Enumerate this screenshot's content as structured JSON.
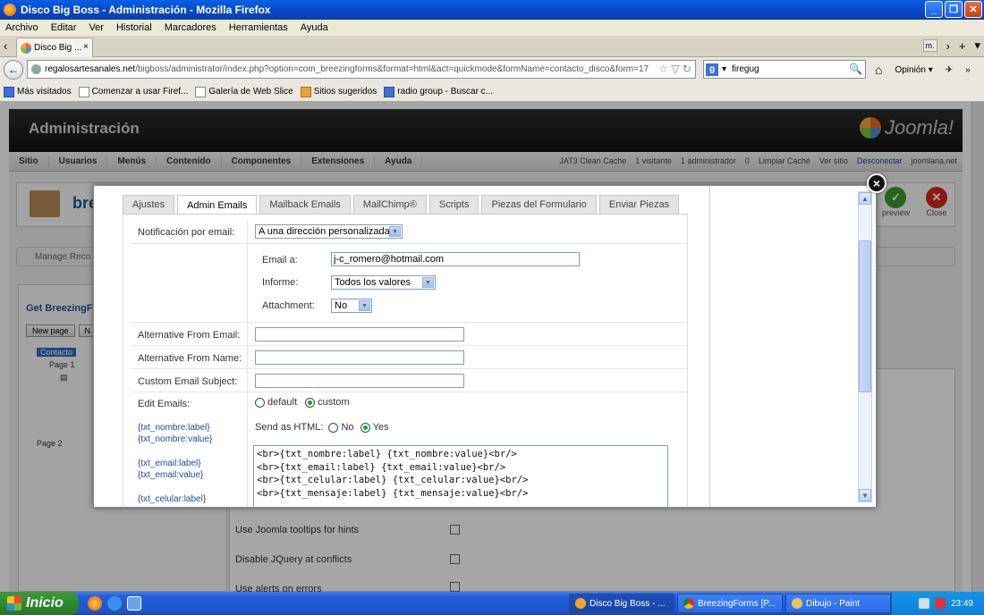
{
  "window": {
    "title": "Disco Big Boss - Administración - Mozilla Firefox",
    "min": "_",
    "max": "❐",
    "close": "✕"
  },
  "menu": [
    "Archivo",
    "Editar",
    "Ver",
    "Historial",
    "Marcadores",
    "Herramientas",
    "Ayuda"
  ],
  "tab": {
    "label": "Disco Big ...",
    "close": "×"
  },
  "tabstrip": {
    "scroll_left": "‹",
    "mini_tab": "m.",
    "scroll_right": "›",
    "new_tab": "+",
    "list": "▾"
  },
  "nav": {
    "back": "←",
    "url_domain": "regalosartesanales.net",
    "url_path": "/bigboss/administrator/index.php?option=com_breezingforms&format=html&act=quickmode&formName=contacto_disco&form=17",
    "url_icons": "☆ ▽ ↻",
    "search_engine": "g",
    "search_arrow": "▾",
    "search_value": "firegug",
    "search_icon": "🔍",
    "home": "⌂",
    "opinion": "Opinión",
    "opinion_arrow": "▾",
    "ext": "✈",
    "more": "»"
  },
  "bookmarks": [
    "Más visitados",
    "Comenzar a usar Firef...",
    "Galería de Web Slice",
    "Sitios sugeridos",
    "radio group - Buscar c..."
  ],
  "admin": {
    "title": "Administración",
    "logo": "Joomla!",
    "menu": [
      "Sitio",
      "Usuarios",
      "Menús",
      "Contenido",
      "Componentes",
      "Extensiones",
      "Ayuda"
    ],
    "status": [
      "JAT3 Clean Cache",
      "1 visitante",
      "1 administrador",
      "0",
      "Limpiar Caché",
      "Ver sitio",
      "Desconectar",
      "joomlana.net"
    ],
    "toolbar_title": "bre",
    "toolbar_preview": "preview",
    "toolbar_close": "Close",
    "manage": "Manage Reco",
    "panel_title": "Get BreezingF",
    "new_page": "New page",
    "panel_btn2": "N",
    "tree_root": "Contacto",
    "tree_page1": "Page 1",
    "tree_page2": "Page 2",
    "options": [
      "Use Joomla tooltips for hints",
      "Disable JQuery at conflicts",
      "Use alerts on errors"
    ]
  },
  "modal": {
    "close_label": "×",
    "tabs": [
      "Ajustes",
      "Admin Emails",
      "Mailback Emails",
      "MailChimp®",
      "Scripts",
      "Piezas del Formulario",
      "Enviar Piezas"
    ],
    "active_tab": "Admin Emails",
    "notif_label": "Notificación por email:",
    "notif_value": "A una dirección personalizada",
    "email_label": "Email a:",
    "email_value": "j-c_romero@hotmail.com",
    "informe_label": "Informe:",
    "informe_value": "Todos los valores",
    "attachment_label": "Attachment:",
    "attachment_value": "No",
    "alt_from_email_label": "Alternative From Email:",
    "alt_from_name_label": "Alternative From Name:",
    "custom_subject_label": "Custom Email Subject:",
    "edit_emails_label": "Edit Emails:",
    "edit_default": "default",
    "edit_custom": "custom",
    "send_html_label": "Send as HTML:",
    "send_no": "No",
    "send_yes": "Yes",
    "placeholders": [
      "{txt_nombre:label}",
      "{txt_nombre:value}",
      "{txt_email:label}",
      "{txt_email:value}",
      "{txt_celular:label}"
    ],
    "code": "<br>{txt_nombre:label} {txt_nombre:value}<br/>\n<br>{txt_email:label} {txt_email:value}<br/>\n<br>{txt_celular:label} {txt_celular:value}<br/>\n<br>{txt_mensaje:label} {txt_mensaje:value}<br/>"
  },
  "taskbar": {
    "start": "Inicio",
    "tasks": [
      "Disco Big Boss - ...",
      "BreezingForms [P...",
      "Dibujo - Paint"
    ],
    "time": "23:49"
  }
}
